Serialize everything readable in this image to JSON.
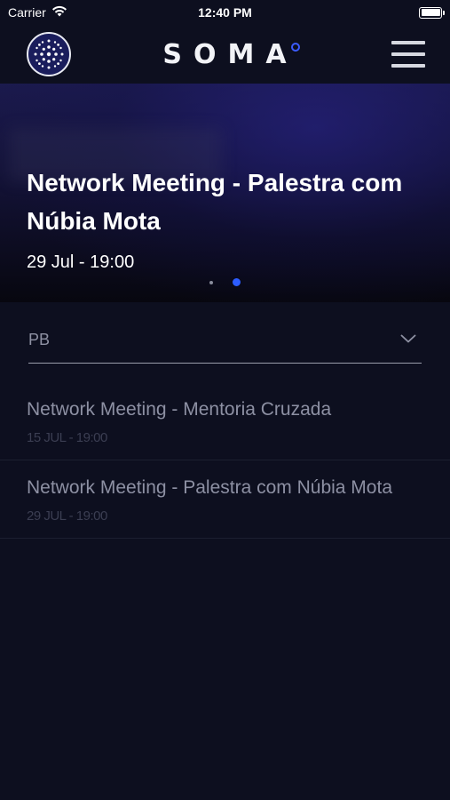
{
  "status_bar": {
    "carrier": "Carrier",
    "time": "12:40 PM"
  },
  "nav": {
    "brand": "SOMA",
    "icons": {
      "logo": "soma-logo-icon",
      "menu": "hamburger-menu-icon"
    }
  },
  "hero": {
    "title": "Network Meeting - Palestra com Núbia Mota",
    "date": "29 Jul - 19:00",
    "pagination": {
      "total": 2,
      "active": 2
    }
  },
  "filter": {
    "selected": "PB"
  },
  "events": [
    {
      "title": "Network Meeting - Mentoria Cruzada",
      "date": "15 JUL - 19:00"
    },
    {
      "title": "Network Meeting - Palestra com Núbia Mota",
      "date": "29 JUL - 19:00"
    }
  ],
  "colors": {
    "background": "#0d0f1f",
    "accent": "#2c5cff",
    "muted_text": "#8d90a3"
  }
}
